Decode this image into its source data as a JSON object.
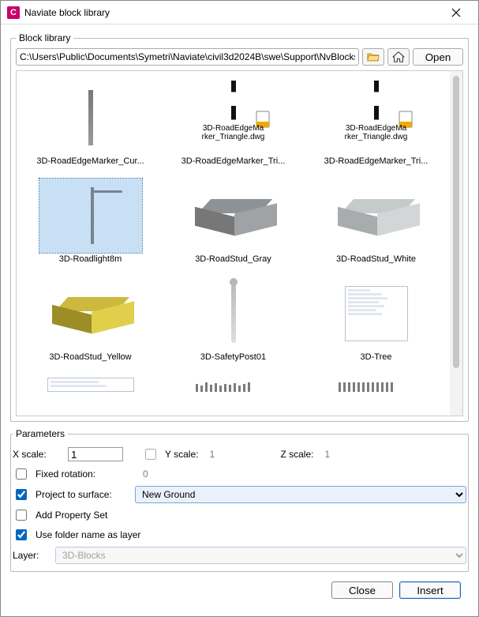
{
  "window": {
    "title": "Naviate block library",
    "icon_letter": "C"
  },
  "block_library": {
    "legend": "Block library",
    "path": "C:\\Users\\Public\\Documents\\Symetri\\Naviate\\civil3d2024B\\swe\\Support\\NvBlocks\\",
    "open_label": "Open"
  },
  "items": [
    {
      "name": "3D-RoadEdgeMarker_Cur..."
    },
    {
      "name": "3D-RoadEdgeMarker_Tri...",
      "dwg_lines": [
        "3D-RoadEdgeMa",
        "rker_Triangle.dwg"
      ]
    },
    {
      "name": "3D-RoadEdgeMarker_Tri...",
      "dwg_lines": [
        "3D-RoadEdgeMa",
        "rker_Triangle.dwg"
      ]
    },
    {
      "name": "3D-Roadlight8m"
    },
    {
      "name": "3D-RoadStud_Gray"
    },
    {
      "name": "3D-RoadStud_White"
    },
    {
      "name": "3D-RoadStud_Yellow"
    },
    {
      "name": "3D-SafetyPost01"
    },
    {
      "name": "3D-Tree"
    }
  ],
  "parameters": {
    "legend": "Parameters",
    "labels": {
      "xscale": "X scale:",
      "yscale": "Y scale:",
      "zscale": "Z scale:",
      "fixed_rotation": "Fixed rotation:",
      "project_surface": "Project to surface:",
      "add_property_set": "Add Property Set",
      "use_folder_as_layer": "Use folder name as layer",
      "layer": "Layer:"
    },
    "xscale_value": "1",
    "yscale_value": "1",
    "zscale_value": "1",
    "yscale_linked": false,
    "fixed_rotation_checked": false,
    "fixed_rotation_value": "0",
    "project_surface_checked": true,
    "surface_selected": "New Ground",
    "add_property_set_checked": false,
    "use_folder_as_layer_checked": true,
    "layer_value": "3D-Blocks"
  },
  "footer": {
    "close": "Close",
    "insert": "Insert"
  }
}
